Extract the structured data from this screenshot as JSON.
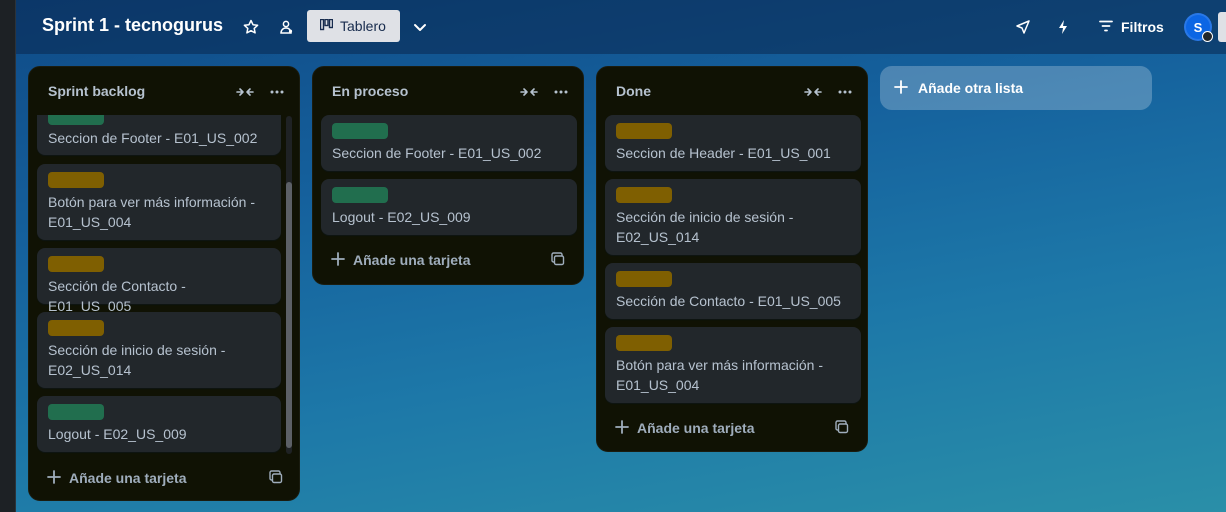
{
  "board": {
    "title": "Sprint 1 - tecnogurus",
    "view_label": "Tablero",
    "filters_label": "Filtros",
    "avatar_initial": "S"
  },
  "colors": {
    "label_green": "#216e4e",
    "label_yellow": "#7f5f01",
    "list_bg": "#101204",
    "card_bg": "#22272b"
  },
  "icons": [
    "star-icon",
    "team-visibility-icon",
    "board-view-icon",
    "chevron-down-icon",
    "rocket-icon",
    "lightning-icon",
    "filter-icon",
    "collapse-icon",
    "more-icon",
    "plus-icon",
    "template-icon"
  ],
  "add_card_label": "Añade una tarjeta",
  "add_list_label": "Añade otra lista",
  "lists": [
    {
      "title": "Sprint backlog",
      "cards": [
        {
          "label": "green",
          "text": "Seccion de Footer - E01_US_002"
        },
        {
          "label": "yellow",
          "text": "Botón para ver más información - E01_US_004"
        },
        {
          "label": "yellow",
          "text": "Sección de Contacto - E01_US_005"
        },
        {
          "label": "yellow",
          "text": "Sección de inicio de sesión - E02_US_014"
        },
        {
          "label": "green",
          "text": "Logout - E02_US_009"
        }
      ]
    },
    {
      "title": "En proceso",
      "cards": [
        {
          "label": "green",
          "text": "Seccion de Footer - E01_US_002"
        },
        {
          "label": "green",
          "text": "Logout - E02_US_009"
        }
      ]
    },
    {
      "title": "Done",
      "cards": [
        {
          "label": "yellow",
          "text": "Seccion de Header - E01_US_001"
        },
        {
          "label": "yellow",
          "text": "Sección de inicio de sesión - E02_US_014"
        },
        {
          "label": "yellow",
          "text": "Sección de Contacto - E01_US_005"
        },
        {
          "label": "yellow",
          "text": "Botón para ver más información - E01_US_004"
        }
      ]
    }
  ]
}
